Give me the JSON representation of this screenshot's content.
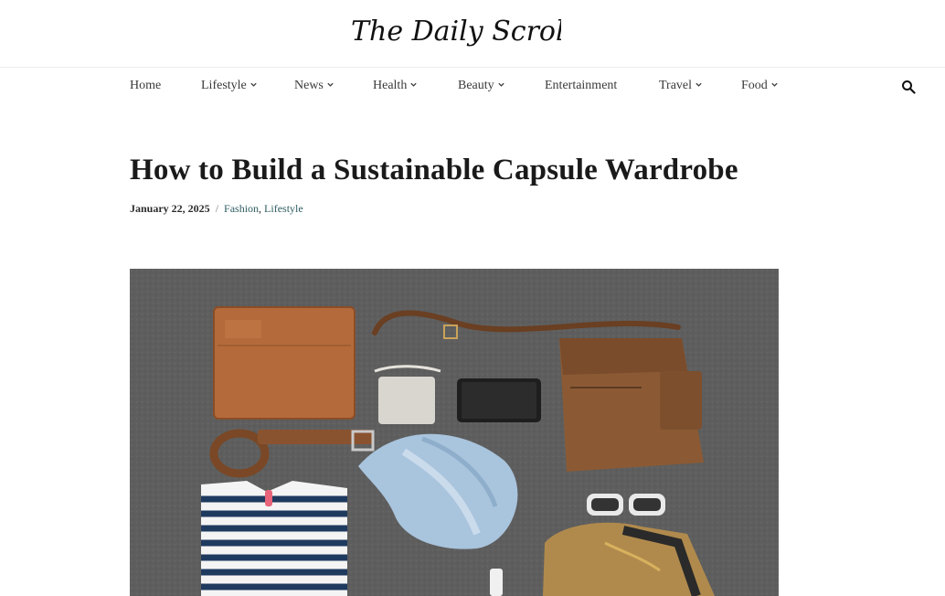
{
  "site": {
    "logo_text": "The Daily Scroll"
  },
  "nav": {
    "items": [
      {
        "label": "Home",
        "has_dropdown": false
      },
      {
        "label": "Lifestyle",
        "has_dropdown": true
      },
      {
        "label": "News",
        "has_dropdown": true
      },
      {
        "label": "Health",
        "has_dropdown": true
      },
      {
        "label": "Beauty",
        "has_dropdown": true
      },
      {
        "label": "Entertainment",
        "has_dropdown": false
      },
      {
        "label": "Travel",
        "has_dropdown": true
      },
      {
        "label": "Food",
        "has_dropdown": true
      }
    ],
    "search_icon": "search-icon"
  },
  "post": {
    "title": "How to Build a Sustainable Capsule Wardrobe",
    "date": "January 22, 2025",
    "separator": "/",
    "categories": [
      "Fashion",
      "Lifestyle"
    ],
    "category_joiner": ","
  },
  "colors": {
    "link": "#2f5d62",
    "text": "#1a1a1a",
    "nav_text": "#3a3a3a",
    "photo_background": "#5b5b5b"
  }
}
